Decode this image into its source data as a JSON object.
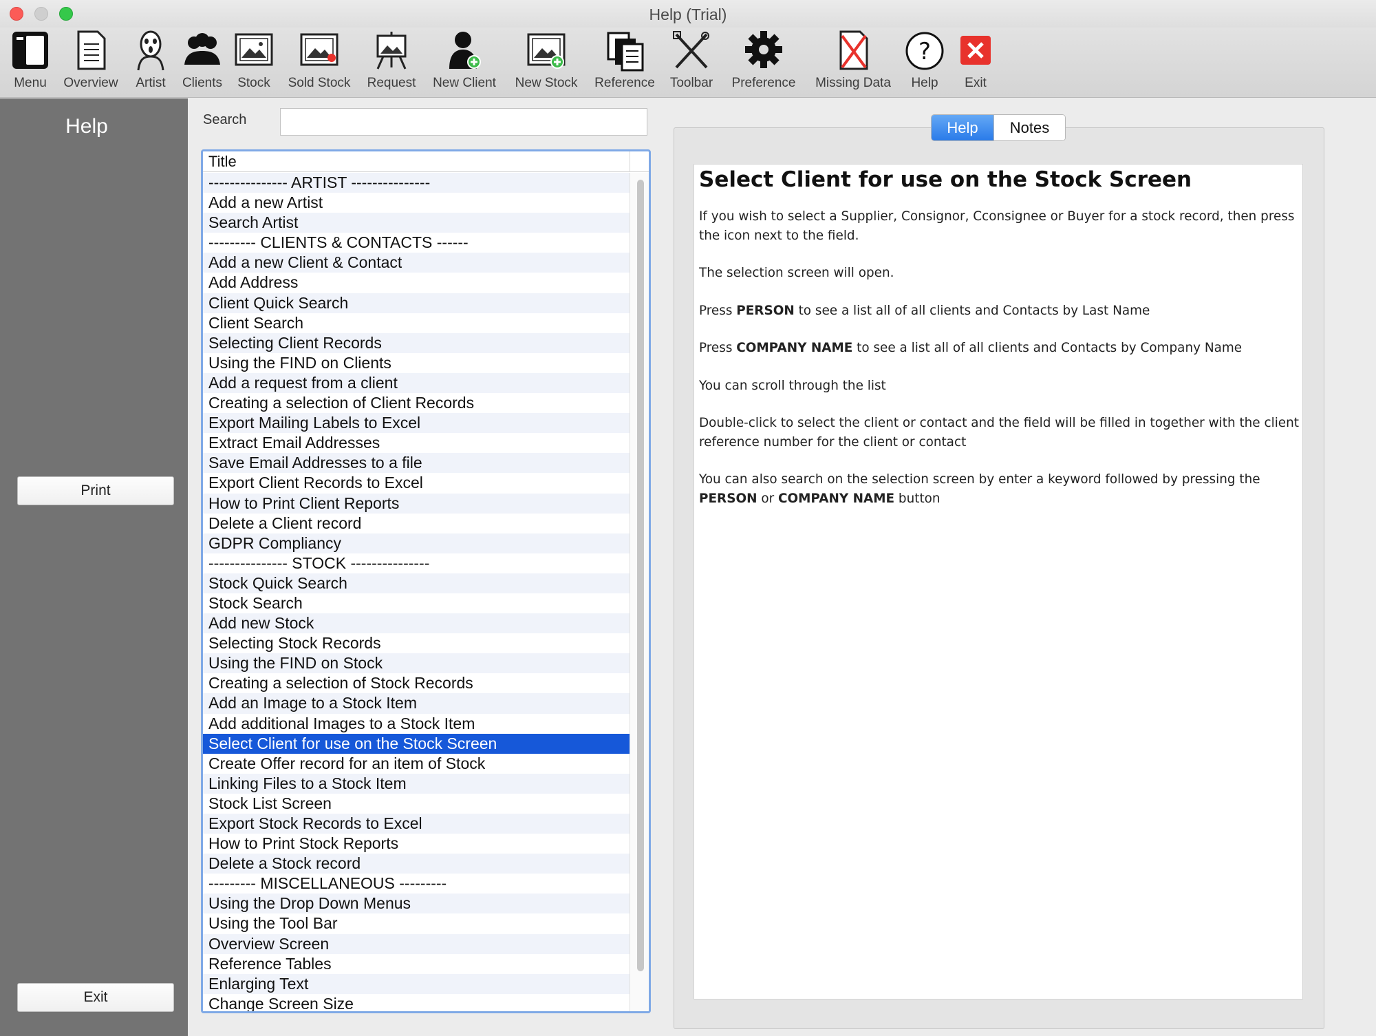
{
  "window": {
    "title": "Help (Trial)"
  },
  "toolbar": [
    {
      "label": "Menu",
      "icon": "menu-icon"
    },
    {
      "label": "Overview",
      "icon": "document-icon"
    },
    {
      "label": "Artist",
      "icon": "scream-artist-icon"
    },
    {
      "label": "Clients",
      "icon": "people-icon"
    },
    {
      "label": "Stock",
      "icon": "picture-icon"
    },
    {
      "label": "Sold Stock",
      "icon": "sold-picture-icon"
    },
    {
      "label": "Request",
      "icon": "easel-icon"
    },
    {
      "label": "New Client",
      "icon": "add-person-icon"
    },
    {
      "label": "New Stock",
      "icon": "add-picture-icon"
    },
    {
      "label": "Reference",
      "icon": "reference-icon"
    },
    {
      "label": "Toolbar",
      "icon": "tools-icon"
    },
    {
      "label": "Preference",
      "icon": "gear-icon"
    },
    {
      "label": "Missing Data",
      "icon": "missing-data-icon"
    },
    {
      "label": "Help",
      "icon": "question-icon"
    },
    {
      "label": "Exit",
      "icon": "close-icon"
    }
  ],
  "sidebar": {
    "title": "Help",
    "print_label": "Print",
    "exit_label": "Exit"
  },
  "search": {
    "label": "Search",
    "value": ""
  },
  "list": {
    "header": "Title",
    "selected_index": 28,
    "items": [
      "--------------- ARTIST ---------------",
      "Add a new Artist",
      "Search Artist",
      "--------- CLIENTS & CONTACTS ------",
      "Add a new Client & Contact",
      "Add Address",
      "Client Quick Search",
      "Client Search",
      "Selecting Client Records",
      "Using the FIND on Clients",
      "Add a request from a client",
      "Creating a selection of Client Records",
      "Export Mailing Labels to Excel",
      "Extract Email Addresses",
      "Save Email Addresses to a file",
      "Export Client Records to Excel",
      "How to Print Client Reports",
      "Delete a Client record",
      "GDPR Compliancy",
      "--------------- STOCK ---------------",
      "Stock Quick Search",
      "Stock Search",
      "Add new Stock",
      "Selecting Stock Records",
      "Using the FIND on Stock",
      "Creating a selection of Stock Records",
      "Add an Image to a Stock Item",
      "Add additional Images to a Stock Item",
      "Select Client for use on the Stock Screen",
      "Create Offer record for an item of Stock",
      "Linking Files to a Stock Item",
      "Stock List Screen",
      "Export Stock Records to Excel",
      "How to Print Stock Reports",
      "Delete a Stock record",
      "--------- MISCELLANEOUS ---------",
      "Using the Drop Down Menus",
      "Using the Tool Bar",
      "Overview Screen",
      "Reference Tables",
      "Enlarging Text",
      "Change Screen Size"
    ]
  },
  "tabs": {
    "help": "Help",
    "notes": "Notes"
  },
  "doc": {
    "title": "Select Client for use on the Stock Screen",
    "p1": "If you wish to select a Supplier, Consignor, Cconsignee or Buyer for a stock record, then press the icon next to the field.",
    "p2": "The selection screen will open.",
    "p3_pre": "Press ",
    "p3_bold": "PERSON",
    "p3_post": " to see a list all of all clients and Contacts by Last Name",
    "p4_pre": "Press ",
    "p4_bold": "COMPANY NAME",
    "p4_post": " to see a list all of all clients and Contacts by Company Name",
    "p5": "You can scroll through the list",
    "p6": "Double-click to select the client or contact and the field will be filled in together with the client reference number for the client or contact",
    "p7_pre": "You can also search on the selection screen by enter a keyword followed by pressing the ",
    "p7_bold1": "PERSON",
    "p7_mid": " or ",
    "p7_bold2": "COMPANY NAME",
    "p7_post": " button"
  },
  "colors": {
    "selection": "#1658d9",
    "sidebar": "#737373",
    "tab_active": "#2a7be9",
    "exit_red": "#e8322c",
    "add_green": "#3dbb4a"
  }
}
